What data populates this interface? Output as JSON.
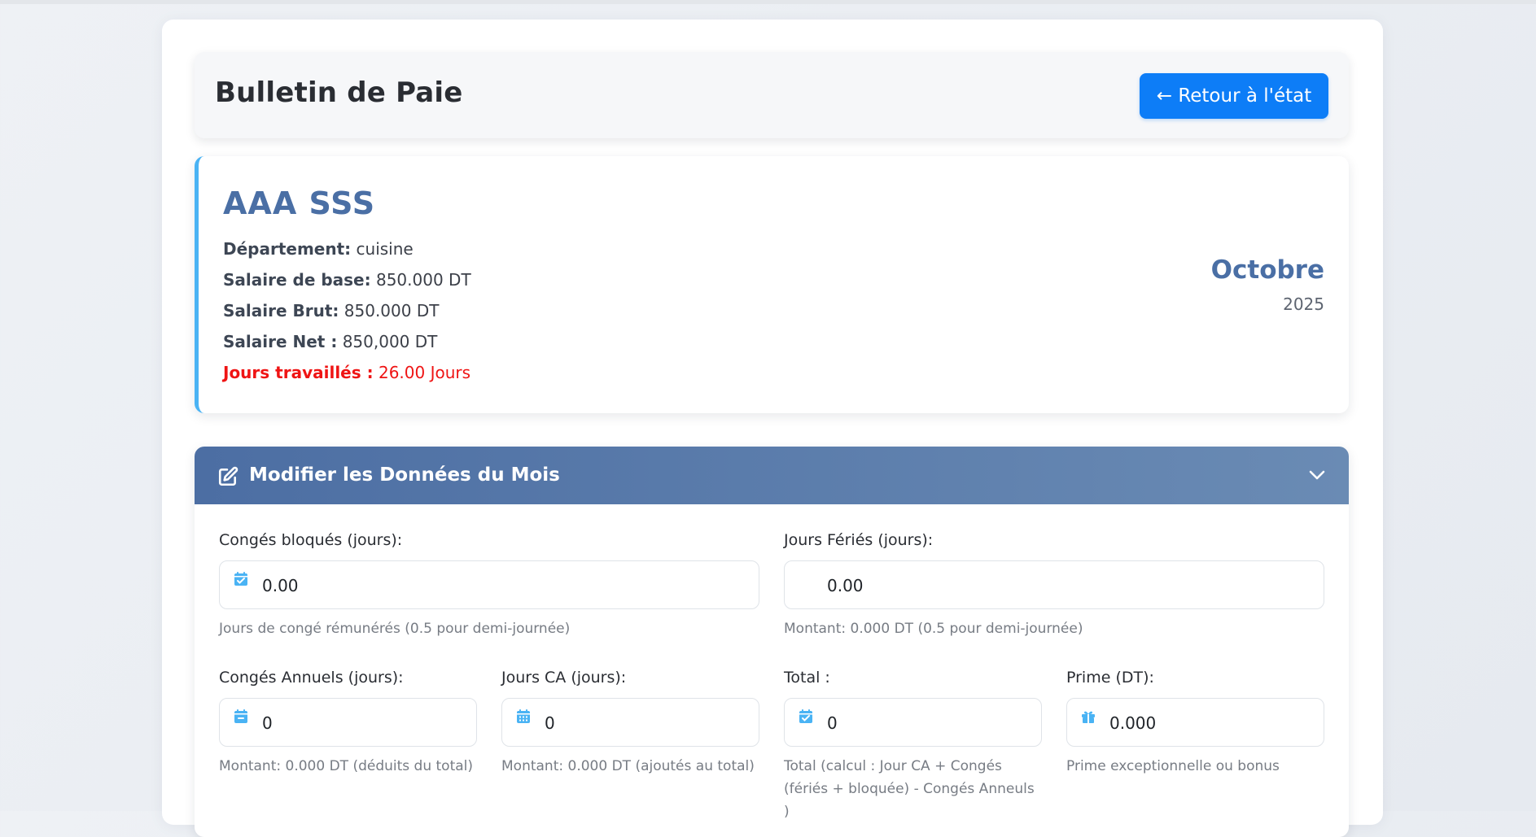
{
  "header": {
    "title": "Bulletin de Paie",
    "back_button": "← Retour à l'état"
  },
  "employee": {
    "name": "AAA SSS",
    "department_label": "Département:",
    "department_value": "cuisine",
    "base_salary_label": "Salaire de base:",
    "base_salary_value": "850.000 DT",
    "gross_salary_label": "Salaire Brut:",
    "gross_salary_value": "850.000 DT",
    "net_salary_label": "Salaire Net :",
    "net_salary_value": "850,000 DT",
    "days_worked_label": "Jours travaillés :",
    "days_worked_value": "26.00 Jours",
    "month": "Octobre",
    "year": "2025"
  },
  "edit_section": {
    "title": "Modifier les Données du Mois",
    "fields": {
      "conges_bloques": {
        "label": "Congés bloqués (jours):",
        "value": "0.00",
        "help": "Jours de congé rémunérés (0.5 pour demi-journée)",
        "icon": "calendar-check-icon"
      },
      "jours_feries": {
        "label": "Jours Fériés (jours):",
        "value": "0.00",
        "help": "Montant: 0.000 DT (0.5 pour demi-journée)"
      },
      "conges_annuels": {
        "label": "Congés Annuels (jours):",
        "value": "0",
        "help": "Montant: 0.000 DT (déduits du total)",
        "icon": "calendar-minus-icon"
      },
      "jours_ca": {
        "label": "Jours CA (jours):",
        "value": "0",
        "help": "Montant: 0.000 DT (ajoutés au total)",
        "icon": "calendar-days-icon"
      },
      "total": {
        "label": "Total :",
        "value": "0",
        "help_line1": "Total (calcul : Jour CA + Congés",
        "help_line2": "(fériés + bloquée) - Congés Anneuls",
        "help_line3": ")",
        "icon": "calendar-check-icon"
      },
      "prime": {
        "label": "Prime (DT):",
        "value": "0.000",
        "help": "Prime exceptionnelle ou bonus",
        "icon": "gift-icon"
      }
    }
  },
  "colors": {
    "accent_blue": "#0d7df7",
    "header_gradient_start": "#4c6ea3",
    "header_gradient_end": "#6a8bb4",
    "name_color": "#4a6fa5",
    "alert_red": "#ef1414",
    "icon_blue": "#4ab3f4"
  }
}
